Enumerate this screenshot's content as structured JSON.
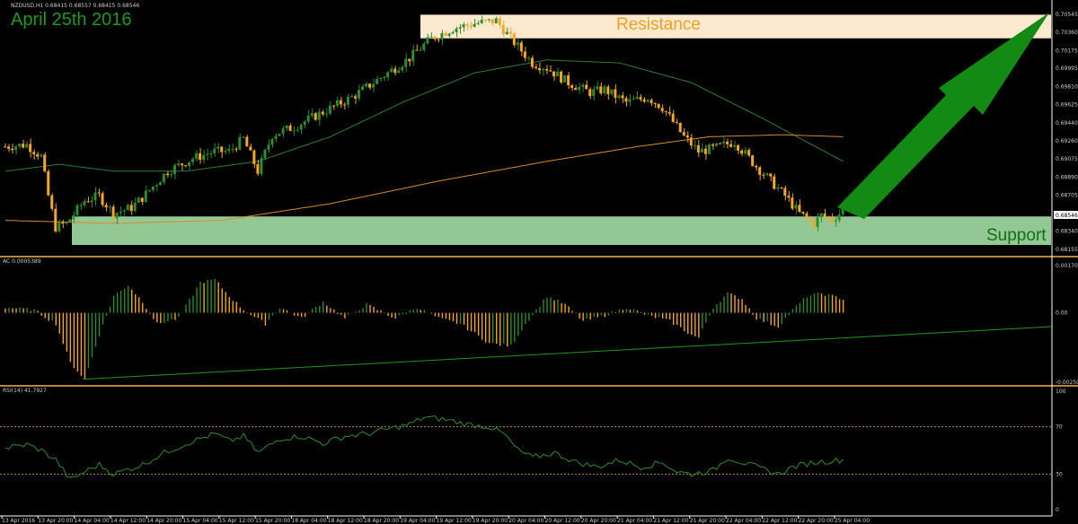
{
  "header": {
    "symbol_info": "NZDUSD,H1  0.68415 0.68557 0.68415 0.68546",
    "date_label": "April 25th 2016"
  },
  "annotations": {
    "resistance_label": "Resistance",
    "support_label": "Support",
    "resistance_zone": [
      0.703,
      0.7054
    ],
    "support_zone": [
      0.682,
      0.6849
    ],
    "current_price": "0.68546"
  },
  "colors": {
    "background": "#000000",
    "bull": "#2e8b2e",
    "bear": "#f5a623",
    "ma_fast": "#2e7d32",
    "ma_slow": "#d98a2b",
    "resistance_fill": "#fde9d0",
    "support_fill": "#93c793",
    "arrow": "#138a13",
    "separator": "#b8862b"
  },
  "chart_data": [
    {
      "type": "candlestick",
      "title": "NZDUSD,H1",
      "y_ticks": [
        "0.70545",
        "0.70360",
        "0.70175",
        "0.69995",
        "0.69810",
        "0.69625",
        "0.69440",
        "0.69260",
        "0.69075",
        "0.68890",
        "0.68705",
        "0.68525",
        "0.68340",
        "0.68155"
      ],
      "ylim": [
        0.681,
        0.7058
      ],
      "x_ticks": [
        "13 Apr 2016",
        "13 Apr 20:00",
        "14 Apr 04:00",
        "14 Apr 12:00",
        "14 Apr 20:00",
        "15 Apr 04:00",
        "15 Apr 12:00",
        "15 Apr 20:00",
        "18 Apr 04:00",
        "18 Apr 12:00",
        "18 Apr 20:00",
        "19 Apr 04:00",
        "19 Apr 12:00",
        "19 Apr 20:00",
        "20 Apr 04:00",
        "20 Apr 12:00",
        "20 Apr 20:00",
        "21 Apr 04:00",
        "21 Apr 12:00",
        "21 Apr 20:00",
        "22 Apr 04:00",
        "22 Apr 12:00",
        "22 Apr 20:00",
        "25 Apr 04:00"
      ],
      "close_anchors": [
        [
          0,
          0.692
        ],
        [
          6,
          0.6922
        ],
        [
          10,
          0.691
        ],
        [
          12,
          0.687
        ],
        [
          14,
          0.6838
        ],
        [
          17,
          0.6842
        ],
        [
          22,
          0.6865
        ],
        [
          26,
          0.687
        ],
        [
          30,
          0.6852
        ],
        [
          35,
          0.6858
        ],
        [
          38,
          0.6868
        ],
        [
          45,
          0.6895
        ],
        [
          52,
          0.6908
        ],
        [
          58,
          0.6915
        ],
        [
          62,
          0.6915
        ],
        [
          66,
          0.6928
        ],
        [
          70,
          0.6895
        ],
        [
          74,
          0.6932
        ],
        [
          80,
          0.694
        ],
        [
          88,
          0.6955
        ],
        [
          96,
          0.697
        ],
        [
          104,
          0.699
        ],
        [
          112,
          0.701
        ],
        [
          118,
          0.703
        ],
        [
          124,
          0.704
        ],
        [
          130,
          0.7045
        ],
        [
          136,
          0.7048
        ],
        [
          140,
          0.703
        ],
        [
          146,
          0.7005
        ],
        [
          150,
          0.7
        ],
        [
          156,
          0.6985
        ],
        [
          162,
          0.6975
        ],
        [
          166,
          0.6978
        ],
        [
          172,
          0.6965
        ],
        [
          178,
          0.697
        ],
        [
          182,
          0.696
        ],
        [
          186,
          0.694
        ],
        [
          188,
          0.693
        ],
        [
          192,
          0.6915
        ],
        [
          196,
          0.6918
        ],
        [
          202,
          0.6925
        ],
        [
          208,
          0.69
        ],
        [
          212,
          0.6885
        ],
        [
          216,
          0.687
        ],
        [
          220,
          0.6852
        ],
        [
          224,
          0.6842
        ],
        [
          226,
          0.685
        ],
        [
          229,
          0.6846
        ],
        [
          232,
          0.6855
        ]
      ],
      "ma_fast_anchors": [
        [
          0,
          0.6895
        ],
        [
          15,
          0.6902
        ],
        [
          30,
          0.6895
        ],
        [
          50,
          0.6895
        ],
        [
          70,
          0.6905
        ],
        [
          90,
          0.693
        ],
        [
          110,
          0.6965
        ],
        [
          130,
          0.6995
        ],
        [
          150,
          0.7008
        ],
        [
          170,
          0.7005
        ],
        [
          190,
          0.6985
        ],
        [
          210,
          0.6948
        ],
        [
          232,
          0.6905
        ]
      ],
      "ma_slow_anchors": [
        [
          0,
          0.6845
        ],
        [
          30,
          0.6842
        ],
        [
          60,
          0.6845
        ],
        [
          90,
          0.6862
        ],
        [
          120,
          0.6885
        ],
        [
          150,
          0.6905
        ],
        [
          175,
          0.692
        ],
        [
          195,
          0.693
        ],
        [
          215,
          0.6932
        ],
        [
          232,
          0.693
        ]
      ],
      "bars": 233
    },
    {
      "type": "bar",
      "title": "AC 0.0005389",
      "y_ticks": [
        "0.001705",
        "0.00",
        "-0.002508"
      ],
      "ylim": [
        -0.002508,
        0.001705
      ],
      "histogram_anchors": [
        [
          0,
          0.0002
        ],
        [
          8,
          0.0001
        ],
        [
          14,
          -0.0004
        ],
        [
          18,
          -0.0018
        ],
        [
          22,
          -0.0024
        ],
        [
          26,
          -0.0008
        ],
        [
          30,
          0.0006
        ],
        [
          34,
          0.001
        ],
        [
          38,
          0.0004
        ],
        [
          42,
          -0.0004
        ],
        [
          48,
          -0.0002
        ],
        [
          54,
          0.0011
        ],
        [
          58,
          0.0012
        ],
        [
          62,
          0.0006
        ],
        [
          66,
          0.0001
        ],
        [
          72,
          -0.0004
        ],
        [
          76,
          0.0002
        ],
        [
          82,
          -0.0002
        ],
        [
          88,
          0.0004
        ],
        [
          94,
          -0.0002
        ],
        [
          100,
          0.0003
        ],
        [
          108,
          -0.0002
        ],
        [
          114,
          0.0002
        ],
        [
          120,
          -0.0002
        ],
        [
          126,
          -0.0004
        ],
        [
          134,
          -0.0011
        ],
        [
          140,
          -0.0012
        ],
        [
          144,
          -0.0004
        ],
        [
          150,
          0.0006
        ],
        [
          155,
          0.0003
        ],
        [
          160,
          -0.0003
        ],
        [
          166,
          -0.0001
        ],
        [
          172,
          0.0002
        ],
        [
          178,
          -0.0001
        ],
        [
          184,
          -0.0003
        ],
        [
          190,
          -0.0008
        ],
        [
          192,
          -0.0009
        ],
        [
          196,
          0.0002
        ],
        [
          200,
          0.0007
        ],
        [
          204,
          0.0005
        ],
        [
          208,
          -0.0002
        ],
        [
          214,
          -0.0005
        ],
        [
          218,
          0.0001
        ],
        [
          222,
          0.0006
        ],
        [
          226,
          0.0007
        ],
        [
          232,
          0.0005
        ]
      ],
      "trendline": [
        [
          22,
          -0.0024
        ],
        [
          280,
          -0.0005
        ]
      ],
      "bars": 233
    },
    {
      "type": "line",
      "title": "RSI(14) 41.7927",
      "y_ticks": [
        "100",
        "70",
        "30",
        "0"
      ],
      "levels": [
        70,
        30
      ],
      "ylim": [
        0,
        100
      ],
      "rsi_anchors": [
        [
          0,
          52
        ],
        [
          6,
          55
        ],
        [
          10,
          50
        ],
        [
          14,
          42
        ],
        [
          18,
          25
        ],
        [
          22,
          32
        ],
        [
          26,
          38
        ],
        [
          30,
          30
        ],
        [
          34,
          34
        ],
        [
          38,
          38
        ],
        [
          44,
          48
        ],
        [
          52,
          58
        ],
        [
          58,
          64
        ],
        [
          62,
          58
        ],
        [
          66,
          62
        ],
        [
          70,
          48
        ],
        [
          76,
          60
        ],
        [
          82,
          62
        ],
        [
          88,
          56
        ],
        [
          94,
          62
        ],
        [
          100,
          64
        ],
        [
          106,
          68
        ],
        [
          112,
          72
        ],
        [
          116,
          78
        ],
        [
          122,
          76
        ],
        [
          128,
          72
        ],
        [
          134,
          70
        ],
        [
          138,
          64
        ],
        [
          142,
          50
        ],
        [
          146,
          44
        ],
        [
          152,
          48
        ],
        [
          158,
          40
        ],
        [
          164,
          36
        ],
        [
          170,
          42
        ],
        [
          176,
          36
        ],
        [
          182,
          40
        ],
        [
          186,
          32
        ],
        [
          190,
          30
        ],
        [
          196,
          33
        ],
        [
          200,
          44
        ],
        [
          206,
          38
        ],
        [
          210,
          34
        ],
        [
          214,
          30
        ],
        [
          218,
          36
        ],
        [
          224,
          40
        ],
        [
          232,
          42
        ]
      ],
      "bars": 233
    }
  ]
}
